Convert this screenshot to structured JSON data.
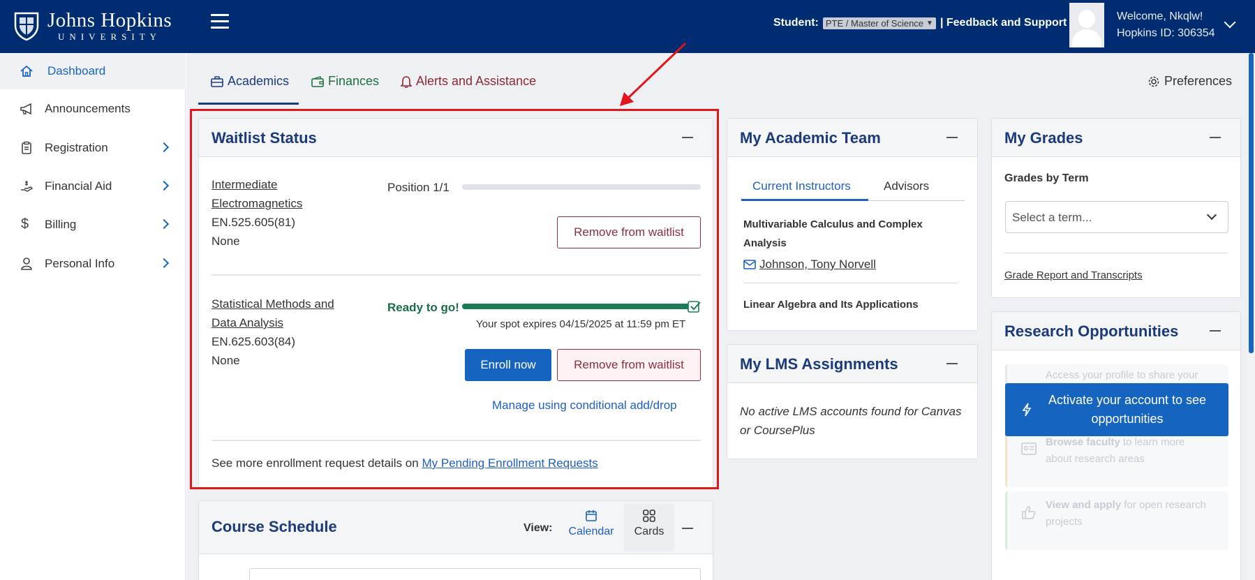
{
  "header": {
    "logo_line1": "Johns Hopkins",
    "logo_line2": "UNIVERSITY",
    "student_label": "Student:",
    "program_select": "PTE / Master of Science",
    "feedback_link": "| Feedback and Support",
    "welcome": "Welcome, Nkqlw!",
    "hopkins_id": "Hopkins ID: 306354"
  },
  "sidebar": {
    "items": [
      {
        "label": "Dashboard",
        "icon": "home-icon"
      },
      {
        "label": "Announcements",
        "icon": "megaphone-icon"
      },
      {
        "label": "Registration",
        "icon": "clipboard-icon"
      },
      {
        "label": "Financial Aid",
        "icon": "hand-money-icon"
      },
      {
        "label": "Billing",
        "icon": "dollar-icon"
      },
      {
        "label": "Personal Info",
        "icon": "person-icon"
      }
    ]
  },
  "tabs": {
    "academics": "Academics",
    "finances": "Finances",
    "alerts": "Alerts and Assistance",
    "preferences": "Preferences"
  },
  "waitlist": {
    "title": "Waitlist Status",
    "courses": [
      {
        "name_line1": "Intermediate",
        "name_line2": "Electromagnetics",
        "code": "EN.525.605(81)",
        "note": "None",
        "position": "Position 1/1",
        "progress": 0,
        "remove": "Remove from waitlist"
      },
      {
        "name_line1": "Statistical Methods and",
        "name_line2": "Data Analysis",
        "code": "EN.625.603(84)",
        "note": "None",
        "status": "Ready to go!",
        "progress": 1,
        "expires": "Your spot expires 04/15/2025 at 11:59 pm ET",
        "enroll": "Enroll now",
        "remove": "Remove from waitlist",
        "manage": "Manage using conditional add/drop"
      }
    ],
    "footer_text": "See more enrollment request details on",
    "footer_link": "My Pending Enrollment Requests"
  },
  "schedule": {
    "title": "Course Schedule",
    "view_label": "View:",
    "calendar": "Calendar",
    "cards": "Cards"
  },
  "team": {
    "title": "My Academic Team",
    "tab_instructors": "Current Instructors",
    "tab_advisors": "Advisors",
    "course1_line1": "Multivariable Calculus and Complex",
    "course1_line2": "Analysis",
    "instructor1": "Johnson, Tony Norvell",
    "course2": "Linear Algebra and Its Applications"
  },
  "lms": {
    "title": "My LMS Assignments",
    "line1": "No active LMS accounts found for Canvas",
    "line2": "or CoursePlus"
  },
  "grades": {
    "title": "My Grades",
    "by_term": "Grades by Term",
    "select_placeholder": "Select a term...",
    "report_link": "Grade Report and Transcripts"
  },
  "research": {
    "title": "Research Opportunities",
    "row1_line1": "Access your profile to share your",
    "row2_bold": "Browse faculty",
    "row2_rest": "to learn more",
    "row2_line2": "about research areas",
    "row3_bold": "View and apply",
    "row3_rest": "for open research",
    "row3_line2": "projects",
    "activate_line1": "Activate your account to see",
    "activate_line2": "opportunities"
  },
  "colors": {
    "header_bg": "#002d72",
    "accent": "#1565c0",
    "success": "#1a7a52",
    "danger": "#8b2f3b",
    "highlight": "#e0161d"
  }
}
